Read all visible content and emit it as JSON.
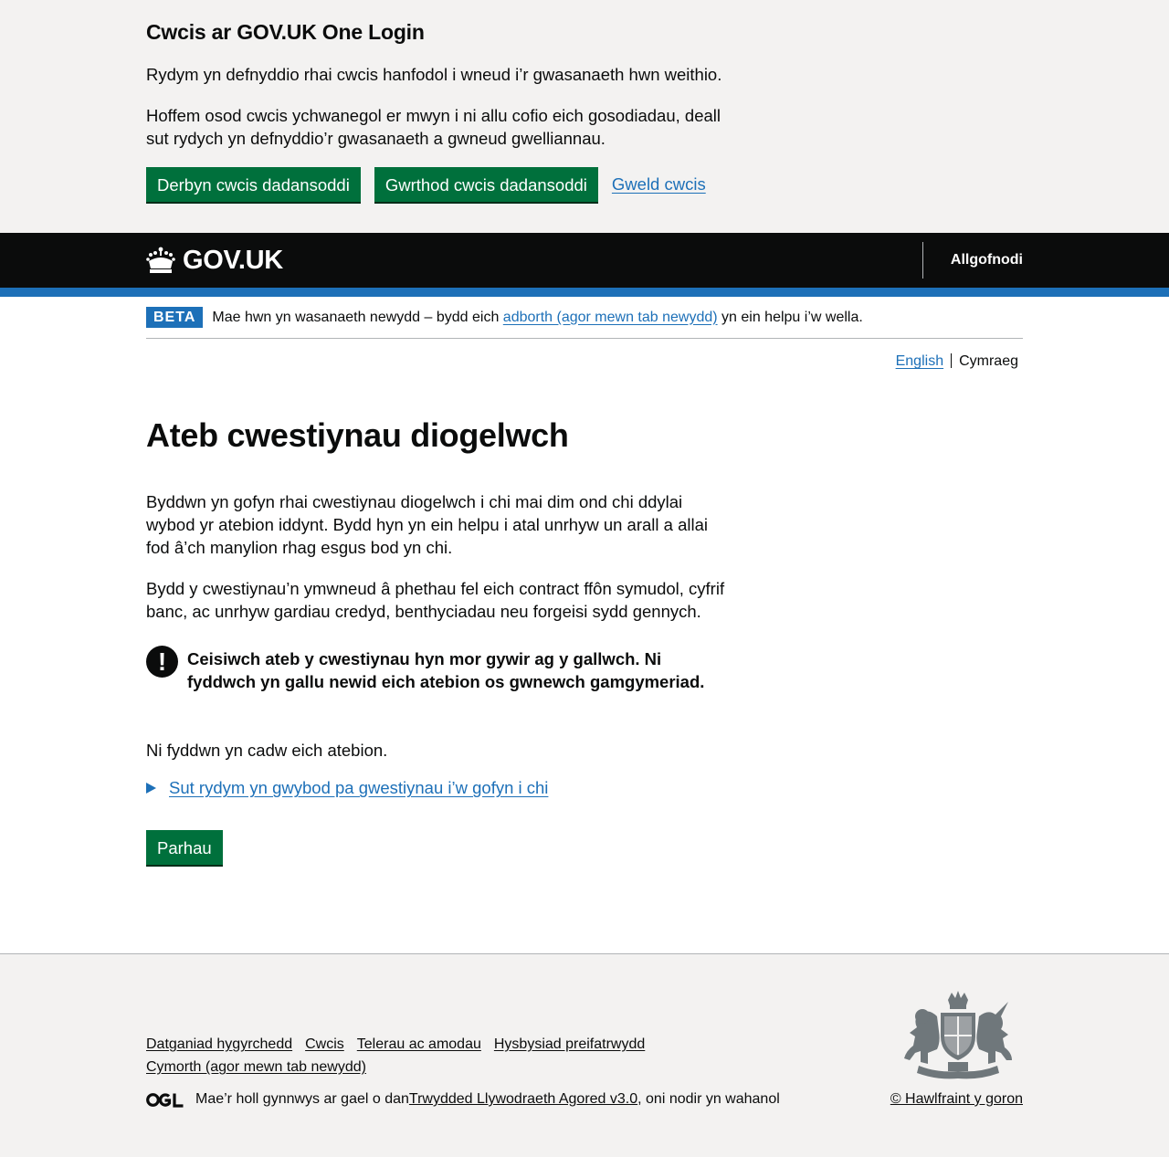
{
  "cookie_banner": {
    "title": "Cwcis ar GOV.UK One Login",
    "p1": "Rydym yn defnyddio rhai cwcis hanfodol i wneud i’r gwasanaeth hwn weithio.",
    "p2": "Hoffem osod cwcis ychwanegol er mwyn i ni allu cofio eich gosodiadau, deall sut rydych yn defnyddio’r gwasanaeth a gwneud gwelliannau.",
    "accept": "Derbyn cwcis dadansoddi",
    "reject": "Gwrthod cwcis dadansoddi",
    "view": "Gweld cwcis"
  },
  "header": {
    "logo_text": "GOV.UK",
    "signout": "Allgofnodi"
  },
  "phase": {
    "tag": "BETA",
    "text_before": "Mae hwn yn wasanaeth newydd – bydd eich ",
    "link": "adborth (agor mewn tab newydd)",
    "text_after": " yn ein helpu i’w wella."
  },
  "language": {
    "english": "English",
    "welsh": "Cymraeg"
  },
  "main": {
    "title": "Ateb cwestiynau diogelwch",
    "p1": "Byddwn yn gofyn rhai cwestiynau diogelwch i chi mai dim ond chi ddylai wybod yr atebion iddynt. Bydd hyn yn ein helpu i atal unrhyw un arall a allai fod â’ch manylion rhag esgus bod yn chi.",
    "p2": "Bydd y cwestiynau’n ymwneud â phethau fel eich contract ffôn symudol, cyfrif banc, ac unrhyw gardiau credyd, benthyciadau neu forgeisi sydd gennych.",
    "warning_icon": "!",
    "warning": "Ceisiwch ateb y cwestiynau hyn mor gywir ag y gallwch. Ni fyddwch yn gallu newid eich atebion os gwnewch gamgymeriad.",
    "p3": "Ni fyddwn yn cadw eich atebion.",
    "details": "Sut rydym yn gwybod pa gwestiynau i’w gofyn i chi",
    "continue": "Parhau"
  },
  "footer": {
    "links": [
      "Datganiad hygyrchedd",
      "Cwcis",
      "Telerau ac amodau",
      "Hysbysiad preifatrwydd",
      "Cymorth (agor mewn tab newydd)"
    ],
    "ogl_before": "Mae’r holl gynnwys ar gael o dan ",
    "ogl_link": "Trwydded Llywodraeth Agored v3.0",
    "ogl_after": ", oni nodir yn wahanol",
    "copyright": "© Hawlfraint y goron"
  },
  "colors": {
    "brand_green": "#00703c",
    "link_blue": "#1d70b8",
    "header_black": "#0b0c0c"
  }
}
